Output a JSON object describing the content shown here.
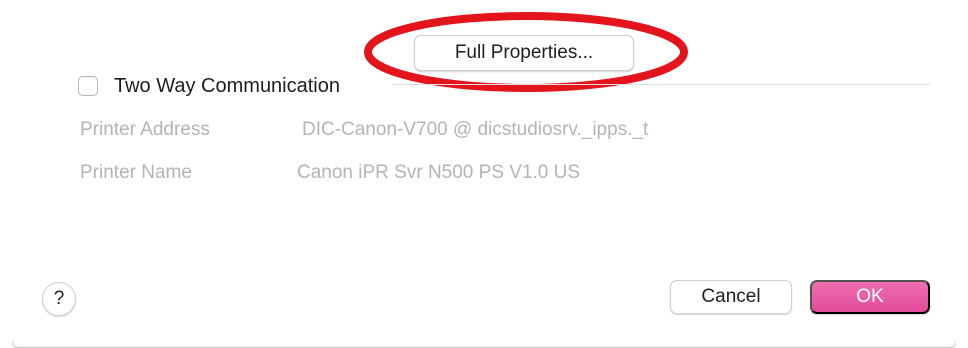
{
  "dialog": {
    "full_properties_label": "Full Properties...",
    "two_way_communication": {
      "label": "Two Way Communication",
      "checked": false
    },
    "printer_address": {
      "label": "Printer Address",
      "value": "DIC-Canon-V700 @ dicstudiosrv._ipps._t"
    },
    "printer_name": {
      "label": "Printer Name",
      "value": "Canon iPR Svr N500 PS V1.0 US"
    },
    "help_label": "?",
    "cancel_label": "Cancel",
    "ok_label": "OK"
  },
  "colors": {
    "accent": "#e65aa4",
    "annotation": "#e3141b",
    "disabled_text": "#b4b4b4"
  },
  "icons": {
    "help": "question-mark-icon"
  }
}
